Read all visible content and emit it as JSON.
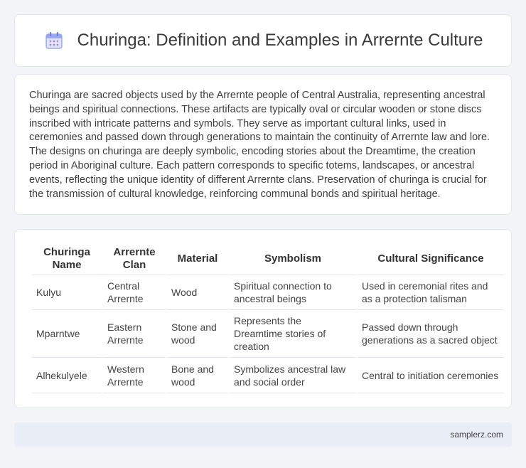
{
  "header": {
    "title": "Churinga: Definition and Examples in Arrernte Culture",
    "icon": "calendar-icon"
  },
  "intro": {
    "text": "Churinga are sacred objects used by the Arrernte people of Central Australia, representing ancestral beings and spiritual connections. These artifacts are typically oval or circular wooden or stone discs inscribed with intricate patterns and symbols. They serve as important cultural links, used in ceremonies and passed down through generations to maintain the continuity of Arrernte law and lore. The designs on churinga are deeply symbolic, encoding stories about the Dreamtime, the creation period in Aboriginal culture. Each pattern corresponds to specific totems, landscapes, or ancestral events, reflecting the unique identity of different Arrernte clans. Preservation of churinga is crucial for the transmission of cultural knowledge, reinforcing communal bonds and spiritual heritage."
  },
  "table": {
    "headers": [
      "Churinga Name",
      "Arrernte Clan",
      "Material",
      "Symbolism",
      "Cultural Significance"
    ],
    "rows": [
      [
        "Kulyu",
        "Central Arrernte",
        "Wood",
        "Spiritual connection to ancestral beings",
        "Used in ceremonial rites and as a protection talisman"
      ],
      [
        "Mparntwe",
        "Eastern Arrernte",
        "Stone and wood",
        "Represents the Dreamtime stories of creation",
        "Passed down through generations as a sacred object"
      ],
      [
        "Alhekulyele",
        "Western Arrernte",
        "Bone and wood",
        "Symbolizes ancestral law and social order",
        "Central to initiation ceremonies"
      ]
    ]
  },
  "footer": {
    "text": "samplerz.com"
  },
  "colors": {
    "background": "#f2f4f8",
    "icon_accent": "#7b8de0",
    "footer_bar": "#e8edf6"
  }
}
